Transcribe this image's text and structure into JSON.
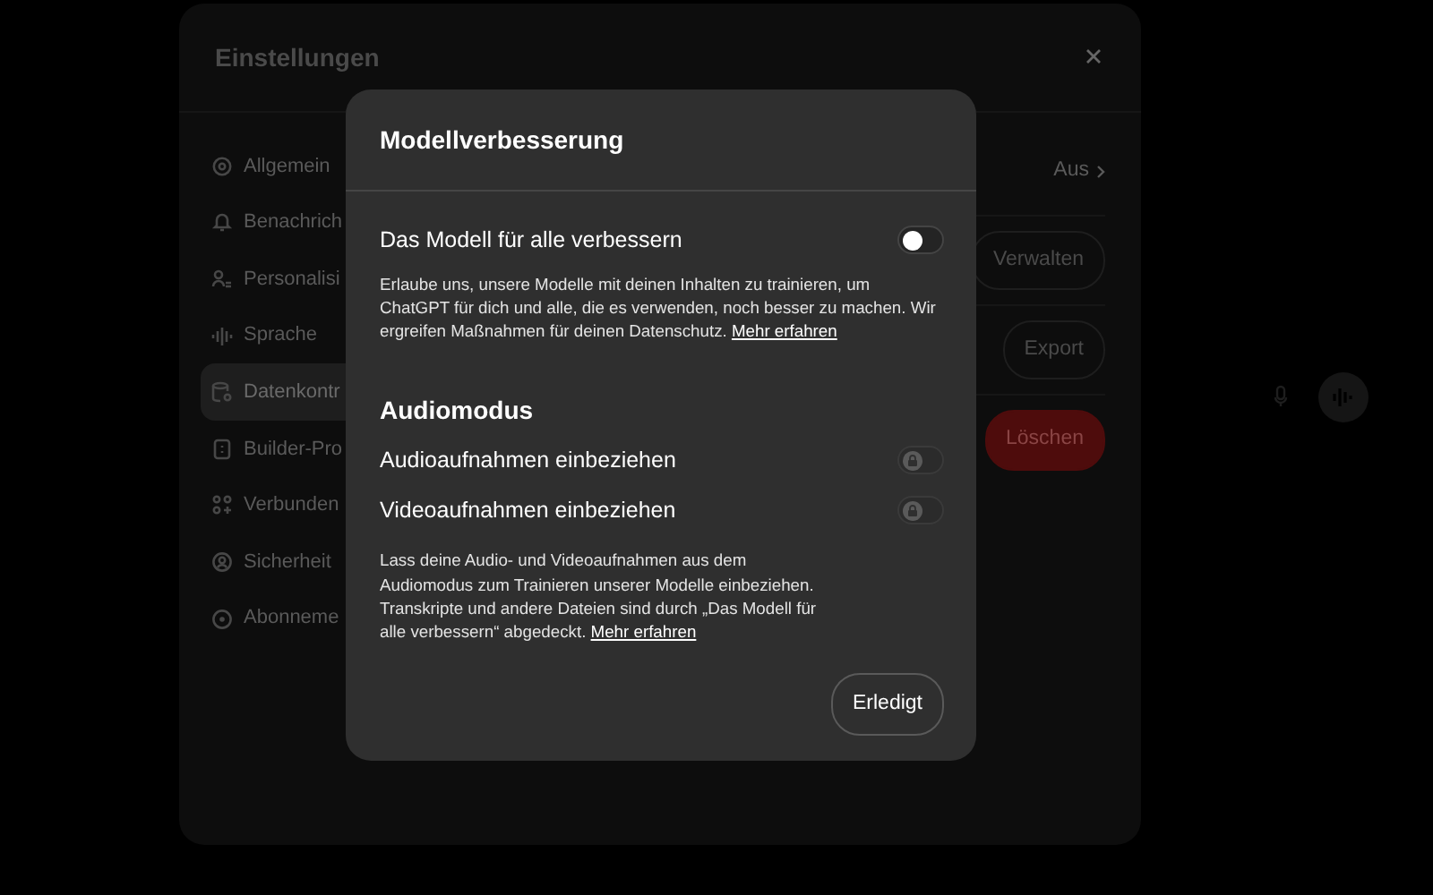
{
  "settings": {
    "title": "Einstellungen",
    "sidebar": [
      {
        "label": "Allgemein",
        "selected": false
      },
      {
        "label": "Benachrich",
        "selected": false
      },
      {
        "label": "Personalisi",
        "selected": false
      },
      {
        "label": "Sprache",
        "selected": false
      },
      {
        "label": "Datenkontr",
        "selected": true
      },
      {
        "label": "Builder-Pro",
        "selected": false
      },
      {
        "label": "Verbunden",
        "selected": false
      },
      {
        "label": "Sicherheit",
        "selected": false
      },
      {
        "label": "Abonneme",
        "selected": false
      }
    ],
    "rows": [
      {
        "kind": "link",
        "label": "Aus"
      },
      {
        "kind": "button",
        "label": "Verwalten"
      },
      {
        "kind": "button",
        "label": "Export"
      },
      {
        "kind": "danger",
        "label": "Löschen"
      }
    ]
  },
  "dialog": {
    "title": "Modellverbesserung",
    "toggle": {
      "label": "Das Modell für alle verbessern",
      "on": false
    },
    "description": "Erlaube uns, unsere Modelle mit deinen Inhalten zu trainieren, um ChatGPT für dich und alle, die es verwenden, noch besser zu machen. Wir ergreifen Maßnahmen für deinen Datenschutz.",
    "description_link": "Mehr erfahren",
    "section": "Audiomodus",
    "section_toggles": [
      {
        "label": "Audioaufnahmen einbeziehen",
        "on": false,
        "locked": true
      },
      {
        "label": "Videoaufnahmen einbeziehen",
        "on": false,
        "locked": true
      }
    ],
    "section_description": "Lass deine Audio- und Videoaufnahmen aus dem Audiomodus zum Trainieren unserer Modelle einbeziehen. Transkripte und andere Dateien sind durch „Das Modell für alle verbessern“ abgedeckt.",
    "section_link": "Mehr erfahren",
    "button": "Erledigt"
  }
}
